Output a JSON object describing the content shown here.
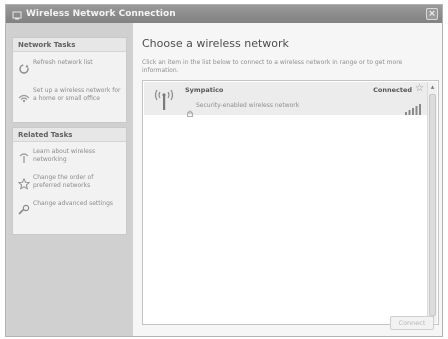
{
  "window": {
    "title": "Wireless Network Connection",
    "close_glyph": "×"
  },
  "sidebar": {
    "network_tasks": {
      "heading": "Network Tasks",
      "items": [
        {
          "label": "Refresh network list",
          "icon": "refresh-icon"
        },
        {
          "label": "Set up a wireless network for a home or small office",
          "icon": "setup-network-icon"
        }
      ]
    },
    "related_tasks": {
      "heading": "Related Tasks",
      "items": [
        {
          "label": "Learn about wireless networking",
          "icon": "info-icon"
        },
        {
          "label": "Change the order of preferred networks",
          "icon": "star-icon"
        },
        {
          "label": "Change advanced settings",
          "icon": "settings-icon"
        }
      ]
    }
  },
  "main": {
    "title": "Choose a wireless network",
    "instructions": "Click an item in the list below to connect to a wireless network in range or to get more information.",
    "networks": [
      {
        "ssid": "Sympatico",
        "status": "Connected",
        "security": "Security-enabled wireless network",
        "signal_bars": 5,
        "preferred": true
      }
    ],
    "connect_label": "Connect"
  },
  "colors": {
    "titlebar": "#8a8a8a",
    "sidebar_bg": "#d0d0d0",
    "panel_bg": "#f2f2f2",
    "selected_item": "#ececec"
  }
}
